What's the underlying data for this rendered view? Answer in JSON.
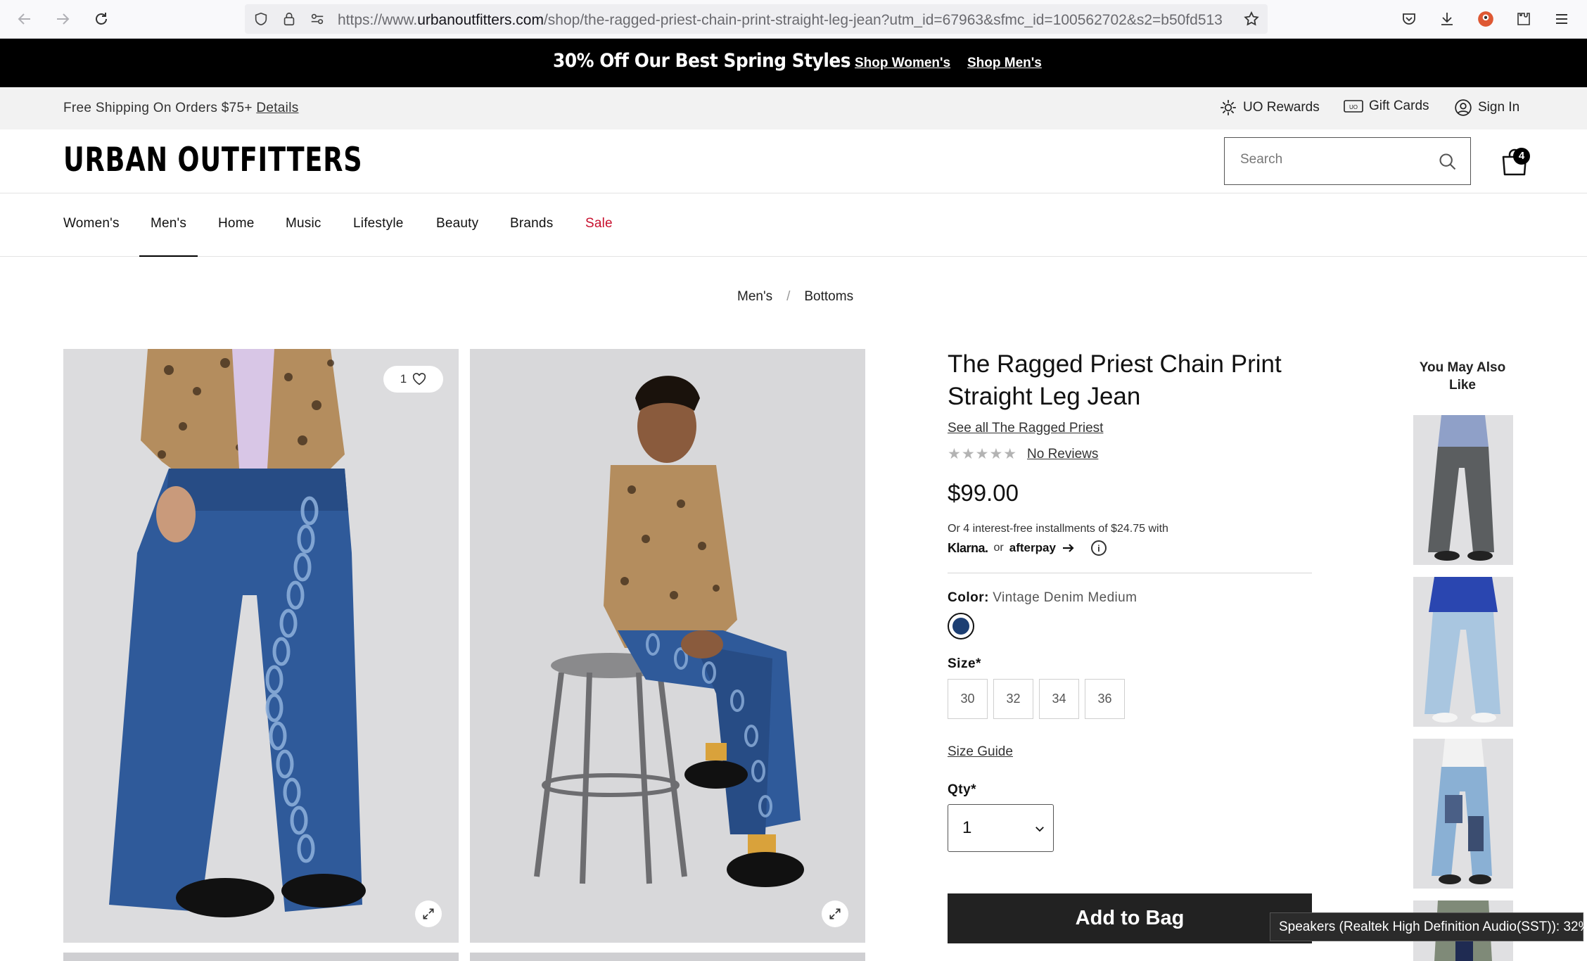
{
  "browser": {
    "url_prefix": "https://www.",
    "url_domain": "urbanoutfitters.com",
    "url_path": "/shop/the-ragged-priest-chain-print-straight-leg-jean?utm_id=67963&sfmc_id=100562702&s2=b50fd513"
  },
  "promo": {
    "title": "30% Off Our Best Spring Styles",
    "link_women": "Shop Women's",
    "link_men": "Shop Men's"
  },
  "utility": {
    "shipping_text": "Free Shipping On Orders $75+",
    "details_link": "Details",
    "rewards": "UO Rewards",
    "gift_cards": "Gift Cards",
    "sign_in": "Sign In"
  },
  "header": {
    "logo": "URBAN OUTFITTERS",
    "search_placeholder": "Search",
    "bag_count": "4"
  },
  "nav": {
    "items": [
      "Women's",
      "Men's",
      "Home",
      "Music",
      "Lifestyle",
      "Beauty",
      "Brands",
      "Sale"
    ],
    "active": "Men's"
  },
  "breadcrumb": {
    "items": [
      "Men's",
      "Bottoms"
    ],
    "separator": "/"
  },
  "gallery": {
    "wishlist_count": "1"
  },
  "product": {
    "title": "The Ragged Priest Chain Print Straight Leg Jean",
    "brand_link": "See all The Ragged Priest",
    "rating_stars": "★★★★★",
    "rating": 0,
    "reviews_link": "No Reviews",
    "price": "$99.00",
    "installments_text": "Or 4 interest-free installments of $24.75 with",
    "klarna": "Klarna.",
    "or_text": "or",
    "afterpay": "afterpay",
    "color_label": "Color:",
    "color_value": "Vintage Denim Medium",
    "color_swatch": "#1d3f73",
    "size_label": "Size*",
    "sizes": [
      "30",
      "32",
      "34",
      "36"
    ],
    "size_guide": "Size Guide",
    "qty_label": "Qty*",
    "qty_value": "1",
    "add_to_bag": "Add to Bag"
  },
  "recommendations": {
    "title": "You May Also Like"
  },
  "system": {
    "volume_tooltip": "Speakers (Realtek High Definition Audio(SST)): 32%"
  },
  "colors": {
    "sale": "#c8102e",
    "promo_bg": "#000000",
    "utility_bg": "#f2f2f2",
    "button_bg": "#222222"
  }
}
